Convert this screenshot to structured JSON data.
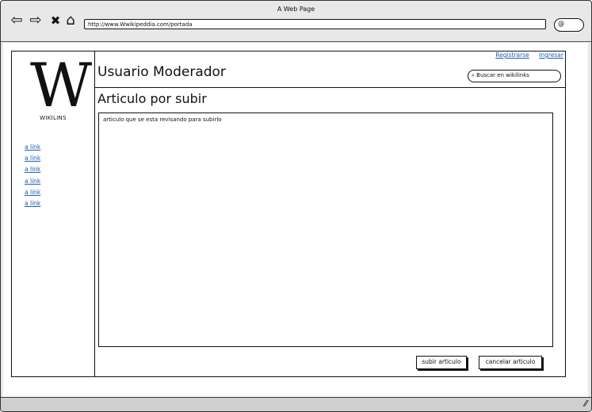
{
  "browser": {
    "title": "A Web Page",
    "url": "http://www.Wwikipeddia.com/portada",
    "back_icon": "⇦",
    "forward_icon": "⇨",
    "stop_icon": "✖",
    "home_icon": "⌂",
    "search_glyph": "@"
  },
  "site": {
    "logo_letter": "W",
    "logo_name": "WIKILINS",
    "page_title": "Usuario Moderador",
    "register_link": "Registrarse",
    "login_link": "Ingresar",
    "search_placeholder": "Buscar en wikilinks",
    "article_heading": "Articulo por subir",
    "editor_text": "articulo que se esta revisando para subirlo",
    "sidebar_links": [
      "a link",
      "a link",
      "a link",
      "a link",
      "a link",
      "a link"
    ],
    "submit_button": "subir articulo",
    "cancel_button": "cancelar articulo"
  },
  "colors": {
    "link": "#1a5fb4"
  }
}
